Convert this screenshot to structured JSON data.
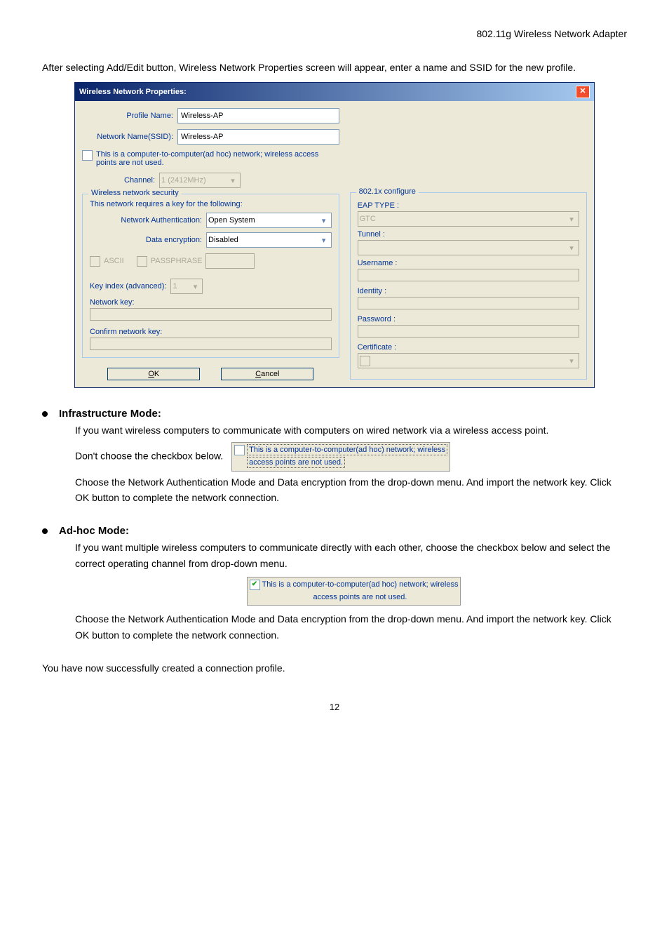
{
  "header": "802.11g Wireless Network Adapter",
  "intro": "After selecting Add/Edit button, Wireless Network Properties screen will appear, enter a name and SSID for the new profile.",
  "dialog": {
    "title": "Wireless Network Properties:",
    "profileNameLabel": "Profile Name:",
    "profileNameValue": "Wireless-AP",
    "ssidLabel": "Network Name(SSID):",
    "ssidValue": "Wireless-AP",
    "adhocLabel": "This is a computer-to-computer(ad hoc) network; wireless access points are not used.",
    "channelLabel": "Channel:",
    "channelValue": "1 (2412MHz)",
    "wnsLegend": "Wireless network security",
    "wnsHeading": "This network requires a key for the following:",
    "authLabel": "Network Authentication:",
    "authValue": "Open System",
    "encLabel": "Data encryption:",
    "encValue": "Disabled",
    "ascii": "ASCII",
    "passphrase": "PASSPHRASE",
    "keyIndexLabel": "Key index (advanced):",
    "keyIndexValue": "1",
    "netKeyLabel": "Network key:",
    "confirmKeyLabel": "Confirm network key:",
    "ok": "OK",
    "cancel": "Cancel",
    "cfgLegend": "802.1x configure",
    "eapTypeLabel": "EAP TYPE :",
    "eapValue": "GTC",
    "tunnelLabel": "Tunnel :",
    "usernameLabel": "Username :",
    "identityLabel": "Identity :",
    "passwordLabel": "Password :",
    "certLabel": "Certificate :"
  },
  "infra": {
    "title": "Infrastructure Mode:",
    "p1": "If you want wireless computers to communicate with computers on wired network via a wireless access point.",
    "dont": "Don't choose the checkbox below.",
    "snip1a": "This is a computer-to-computer(ad hoc) network; wireless",
    "snip1b": "access points are not used.",
    "p2": "Choose the Network Authentication Mode and Data encryption from the drop-down menu. And import the network key. Click OK button to complete the network connection."
  },
  "adhoc": {
    "title": "Ad-hoc Mode:",
    "p1": "If you want multiple wireless computers to communicate directly with each other, choose the checkbox below and select the correct operating channel from drop-down menu.",
    "snip2a": "This is a computer-to-computer(ad hoc) network; wireless",
    "snip2b": "access points are not used.",
    "p2": "Choose the Network Authentication Mode and Data encryption from the drop-down menu. And import the network key. Click OK button to complete the network connection."
  },
  "final": "You have now successfully created a connection profile.",
  "pageNum": "12"
}
